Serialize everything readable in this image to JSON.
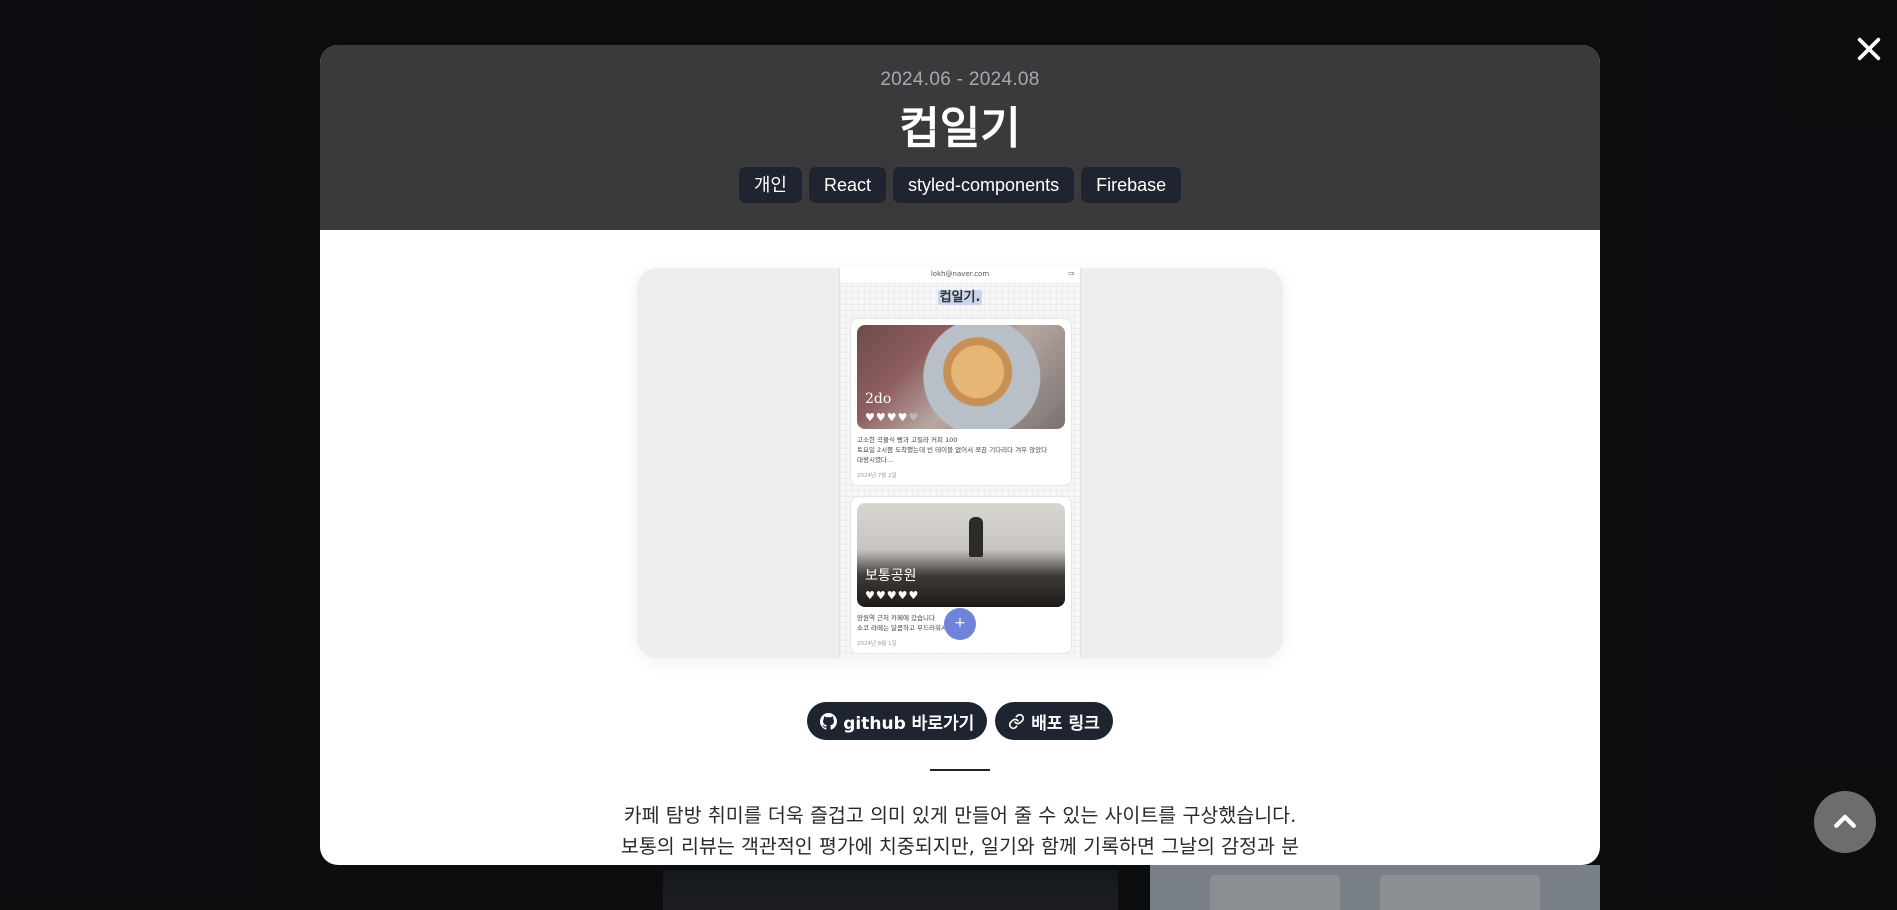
{
  "modal": {
    "period": "2024.06 - 2024.08",
    "title": "컵일기",
    "tags": [
      "개인",
      "React",
      "styled-components",
      "Firebase"
    ],
    "preview": {
      "topbar_email": "lokh@naver.com",
      "logo": "컵일기.",
      "cards": [
        {
          "name": "2do",
          "rating": 4,
          "text_line1": "고소한 곡물식 빵과 고릴라 커피 100",
          "text_line2": "토요일 2시쯤 도착했는데 빈 테이블 없어서 쪼끔 기다리다 겨우 앉았다",
          "text_line3": "대왕시였다...",
          "date": "2024년 7월 2일"
        },
        {
          "name": "보통공원",
          "rating": 5,
          "text_line1": "망원역 근처 카페에 갔습니다",
          "text_line2": "쇼코 라떼는 달콤하고 부드러워서 좋았다...",
          "date": "2024년 8월 1일"
        }
      ],
      "fab_label": "+"
    },
    "links": {
      "github": "github 바로가기",
      "deploy": "배포 링크"
    },
    "description": [
      "카페 탐방 취미를 더욱 즐겁고 의미 있게 만들어 줄 수 있는 사이트를 구상했습니다.",
      "보통의 리뷰는 객관적인 평가에 치중되지만, 일기와 함께 기록하면 그날의 감정과 분"
    ]
  },
  "icons": {
    "close": "close-icon",
    "scroll_top": "chevron-up-icon",
    "github": "github-icon",
    "link": "link-icon"
  }
}
